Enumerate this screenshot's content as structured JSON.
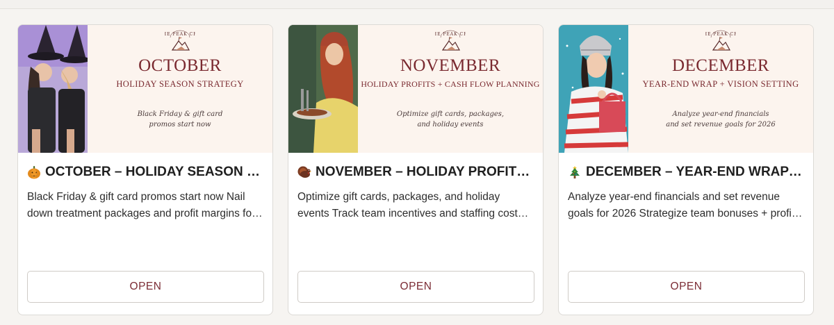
{
  "theme": {
    "accent": "#7b2c35",
    "card_bg": "#ffffff",
    "banner_bg": "#fcf4ee",
    "page_bg": "#f6f4f1"
  },
  "brand": {
    "logo_text": "THE PEAK CFO"
  },
  "cards": [
    {
      "icon": "pumpkin-icon",
      "banner_month": "OCTOBER",
      "banner_subtitle": "HOLIDAY SEASON STRATEGY",
      "banner_tagline_1": "Black Friday & gift card",
      "banner_tagline_2": "promos start now",
      "title": "OCTOBER – HOLIDAY SEASON STRATEGY",
      "description": "Black Friday & gift card promos start now Nail down treatment packages and profit margins for the holiday season",
      "button_label": "OPEN"
    },
    {
      "icon": "turkey-icon",
      "banner_month": "NOVEMBER",
      "banner_subtitle": "HOLIDAY PROFITS + CASH FLOW PLANNING",
      "banner_tagline_1": "Optimize gift cards, packages,",
      "banner_tagline_2": "and holiday events",
      "title": "NOVEMBER – HOLIDAY PROFITS + CASH FLOW PLANNING",
      "description": "Optimize gift cards, packages, and holiday events Track team incentives and staffing costs during the busy season",
      "button_label": "OPEN"
    },
    {
      "icon": "christmas-tree-icon",
      "banner_month": "DECEMBER",
      "banner_subtitle": "YEAR-END WRAP + VISION SETTING",
      "banner_tagline_1": "Analyze year-end financials",
      "banner_tagline_2": "and set revenue goals for 2026",
      "title": "DECEMBER – YEAR-END WRAP + VISION SETTING",
      "description": "Analyze year-end financials and set revenue goals for 2026 Strategize team bonuses + profit sharing for the new year",
      "button_label": "OPEN"
    }
  ]
}
